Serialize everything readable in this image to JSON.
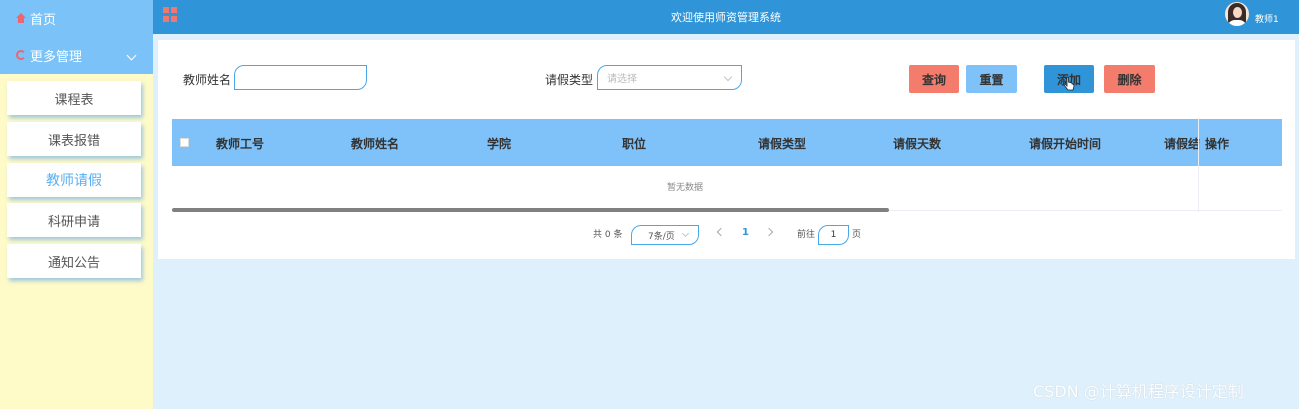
{
  "sidebar": {
    "home_label": "首页",
    "more_label": "更多管理",
    "items": [
      {
        "label": "课程表"
      },
      {
        "label": "课表报错"
      },
      {
        "label": "教师请假"
      },
      {
        "label": "科研申请"
      },
      {
        "label": "通知公告"
      }
    ],
    "active_item": "教师请假"
  },
  "header": {
    "title": "欢迎使用师资管理系统",
    "user_name": "教师1"
  },
  "search": {
    "teacher_name_label": "教师姓名",
    "teacher_name_value": "",
    "leave_type_label": "请假类型",
    "leave_type_placeholder": "请选择"
  },
  "buttons": {
    "query": "查询",
    "reset": "重置",
    "add": "添加",
    "delete": "删除"
  },
  "table": {
    "columns": [
      "教师工号",
      "教师姓名",
      "学院",
      "职位",
      "请假类型",
      "请假天数",
      "请假开始时间",
      "请假结",
      "操作"
    ],
    "empty_text": "暂无数据"
  },
  "pagination": {
    "total_text": "共 0 条",
    "page_size": "7条/页",
    "current_page": "1",
    "goto_label": "前往",
    "goto_value": "1",
    "page_unit": "页"
  },
  "watermark": "CSDN @计算机程序设计定制",
  "colors": {
    "header_bg": "#2f95d8",
    "sidebar_top": "#7ac2f7",
    "sidebar_bg": "#fffbc8",
    "table_head": "#7ec2f9",
    "danger_btn": "#f47c6c",
    "page_bg": "#dff0fd"
  }
}
